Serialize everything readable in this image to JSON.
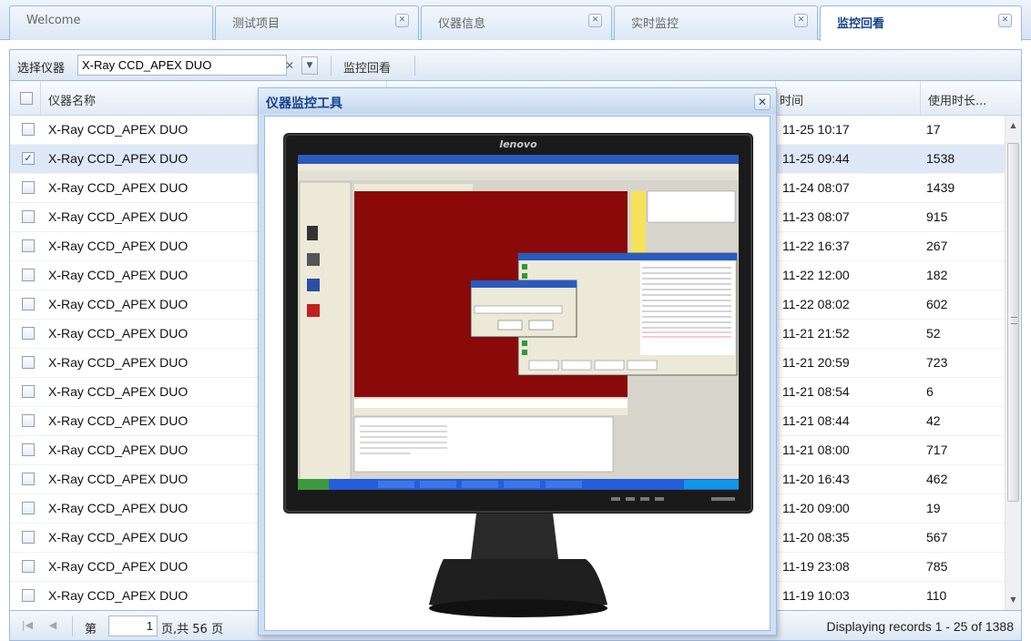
{
  "tabs": [
    {
      "label": "Welcome",
      "closable": false
    },
    {
      "label": "测试项目",
      "closable": true
    },
    {
      "label": "仪器信息",
      "closable": true
    },
    {
      "label": "实时监控",
      "closable": true
    },
    {
      "label": "监控回看",
      "closable": true,
      "active": true
    }
  ],
  "toolbar": {
    "select_label": "选择仪器",
    "select_value": "X-Ray CCD_APEX DUO",
    "button_label": "监控回看"
  },
  "grid": {
    "columns": {
      "name": "仪器名称",
      "time_partial": "时间",
      "duration": "使用时长..."
    },
    "rows": [
      {
        "name": "X-Ray CCD_APEX DUO",
        "time": "11-25 10:17",
        "duration": "17",
        "checked": false
      },
      {
        "name": "X-Ray CCD_APEX DUO",
        "time": "11-25 09:44",
        "duration": "1538",
        "checked": true
      },
      {
        "name": "X-Ray CCD_APEX DUO",
        "time": "11-24 08:07",
        "duration": "1439",
        "checked": false
      },
      {
        "name": "X-Ray CCD_APEX DUO",
        "time": "11-23 08:07",
        "duration": "915",
        "checked": false
      },
      {
        "name": "X-Ray CCD_APEX DUO",
        "time": "11-22 16:37",
        "duration": "267",
        "checked": false
      },
      {
        "name": "X-Ray CCD_APEX DUO",
        "time": "11-22 12:00",
        "duration": "182",
        "checked": false
      },
      {
        "name": "X-Ray CCD_APEX DUO",
        "time": "11-22 08:02",
        "duration": "602",
        "checked": false
      },
      {
        "name": "X-Ray CCD_APEX DUO",
        "time": "11-21 21:52",
        "duration": "52",
        "checked": false
      },
      {
        "name": "X-Ray CCD_APEX DUO",
        "time": "11-21 20:59",
        "duration": "723",
        "checked": false
      },
      {
        "name": "X-Ray CCD_APEX DUO",
        "time": "11-21 08:54",
        "duration": "6",
        "checked": false
      },
      {
        "name": "X-Ray CCD_APEX DUO",
        "time": "11-21 08:44",
        "duration": "42",
        "checked": false
      },
      {
        "name": "X-Ray CCD_APEX DUO",
        "time": "11-21 08:00",
        "duration": "717",
        "checked": false
      },
      {
        "name": "X-Ray CCD_APEX DUO",
        "time": "11-20 16:43",
        "duration": "462",
        "checked": false
      },
      {
        "name": "X-Ray CCD_APEX DUO",
        "time": "11-20 09:00",
        "duration": "19",
        "checked": false
      },
      {
        "name": "X-Ray CCD_APEX DUO",
        "time": "11-20 08:35",
        "duration": "567",
        "checked": false
      },
      {
        "name": "X-Ray CCD_APEX DUO",
        "time": "11-19 23:08",
        "duration": "785",
        "checked": false
      },
      {
        "name": "X-Ray CCD_APEX DUO",
        "time": "11-19 10:03",
        "duration": "110",
        "checked": false
      }
    ]
  },
  "pager": {
    "page_prefix": "第",
    "page_value": "1",
    "page_suffix": "页,共 56 页",
    "display": "Displaying records 1 - 25 of 1388"
  },
  "modal": {
    "title": "仪器监控工具",
    "monitor_brand": "lenovo"
  },
  "colors": {
    "accent_border": "#99bbe8",
    "title_blue": "#15428b",
    "selected_row": "#dfe8f6",
    "screen_red": "#8a0a0a"
  }
}
